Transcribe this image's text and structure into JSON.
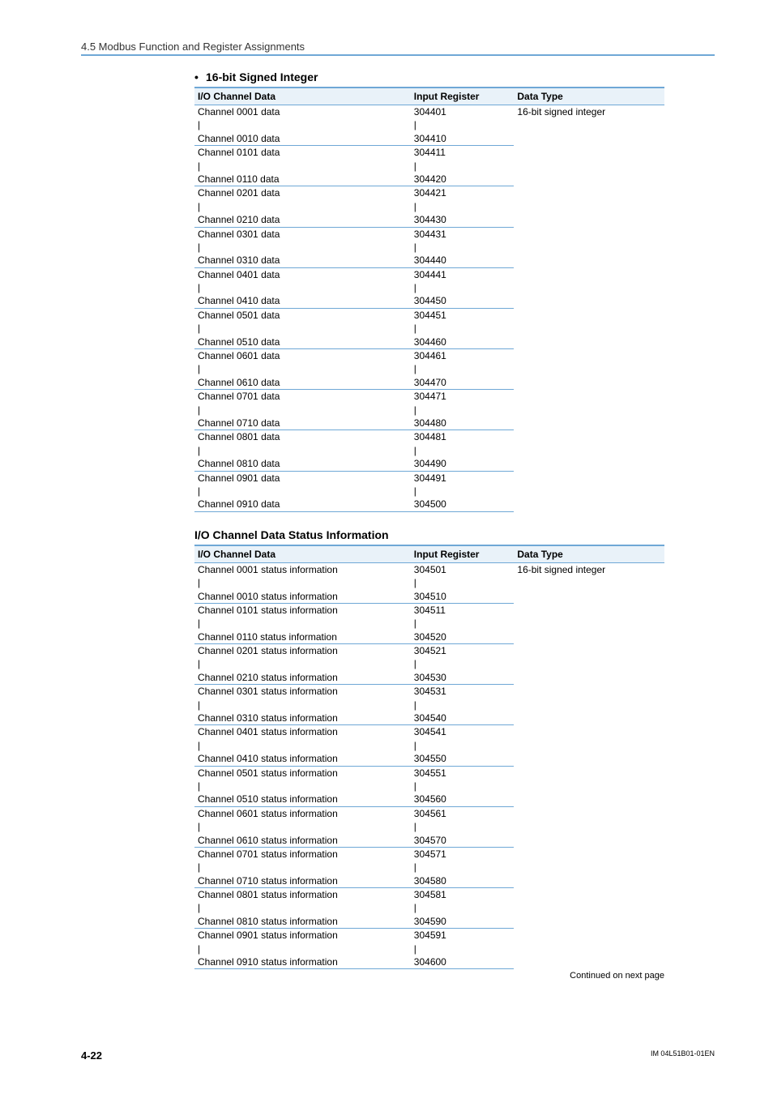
{
  "header": {
    "section": "4.5  Modbus Function and Register Assignments"
  },
  "table1": {
    "bullet_title": "16-bit Signed Integer",
    "head": {
      "c1": "I/O Channel Data",
      "c2": "Input Register",
      "c3": "Data Type"
    },
    "dtype": "16-bit signed integer",
    "groups": [
      {
        "top_label": "Channel 0001 data",
        "top_reg": "304401",
        "bot_label": "Channel 0010 data",
        "bot_reg": "304410"
      },
      {
        "top_label": "Channel 0101 data",
        "top_reg": "304411",
        "bot_label": "Channel 0110 data",
        "bot_reg": "304420"
      },
      {
        "top_label": "Channel 0201 data",
        "top_reg": "304421",
        "bot_label": "Channel 0210 data",
        "bot_reg": "304430"
      },
      {
        "top_label": "Channel 0301 data",
        "top_reg": "304431",
        "bot_label": "Channel 0310 data",
        "bot_reg": "304440"
      },
      {
        "top_label": "Channel 0401 data",
        "top_reg": "304441",
        "bot_label": "Channel 0410 data",
        "bot_reg": "304450"
      },
      {
        "top_label": "Channel 0501 data",
        "top_reg": "304451",
        "bot_label": "Channel 0510 data",
        "bot_reg": "304460"
      },
      {
        "top_label": "Channel 0601 data",
        "top_reg": "304461",
        "bot_label": "Channel 0610 data",
        "bot_reg": "304470"
      },
      {
        "top_label": "Channel 0701 data",
        "top_reg": "304471",
        "bot_label": "Channel 0710 data",
        "bot_reg": "304480"
      },
      {
        "top_label": "Channel 0801 data",
        "top_reg": "304481",
        "bot_label": "Channel 0810 data",
        "bot_reg": "304490"
      },
      {
        "top_label": "Channel 0901 data",
        "top_reg": "304491",
        "bot_label": "Channel 0910 data",
        "bot_reg": "304500"
      }
    ]
  },
  "table2": {
    "title": "I/O Channel Data Status Information",
    "head": {
      "c1": "I/O Channel Data",
      "c2": "Input Register",
      "c3": "Data Type"
    },
    "dtype": "16-bit signed integer",
    "groups": [
      {
        "top_label": "Channel 0001 status information",
        "top_reg": "304501",
        "bot_label": "Channel 0010 status information",
        "bot_reg": "304510"
      },
      {
        "top_label": "Channel 0101 status information",
        "top_reg": "304511",
        "bot_label": "Channel 0110 status information",
        "bot_reg": "304520"
      },
      {
        "top_label": "Channel 0201 status information",
        "top_reg": "304521",
        "bot_label": "Channel 0210 status information",
        "bot_reg": "304530"
      },
      {
        "top_label": "Channel 0301 status information",
        "top_reg": "304531",
        "bot_label": "Channel 0310 status information",
        "bot_reg": "304540"
      },
      {
        "top_label": "Channel 0401 status information",
        "top_reg": "304541",
        "bot_label": "Channel 0410 status information",
        "bot_reg": "304550"
      },
      {
        "top_label": "Channel 0501 status information",
        "top_reg": "304551",
        "bot_label": "Channel 0510 status information",
        "bot_reg": "304560"
      },
      {
        "top_label": "Channel 0601 status information",
        "top_reg": "304561",
        "bot_label": "Channel 0610 status information",
        "bot_reg": "304570"
      },
      {
        "top_label": "Channel 0701 status information",
        "top_reg": "304571",
        "bot_label": "Channel 0710 status information",
        "bot_reg": "304580"
      },
      {
        "top_label": "Channel 0801 status information",
        "top_reg": "304581",
        "bot_label": "Channel 0810 status information",
        "bot_reg": "304590"
      },
      {
        "top_label": "Channel 0901 status information",
        "top_reg": "304591",
        "bot_label": "Channel 0910 status information",
        "bot_reg": "304600"
      }
    ],
    "continued": "Continued on next page"
  },
  "footer": {
    "page": "4-22",
    "docid": "IM 04L51B01-01EN"
  },
  "pipe": "|"
}
